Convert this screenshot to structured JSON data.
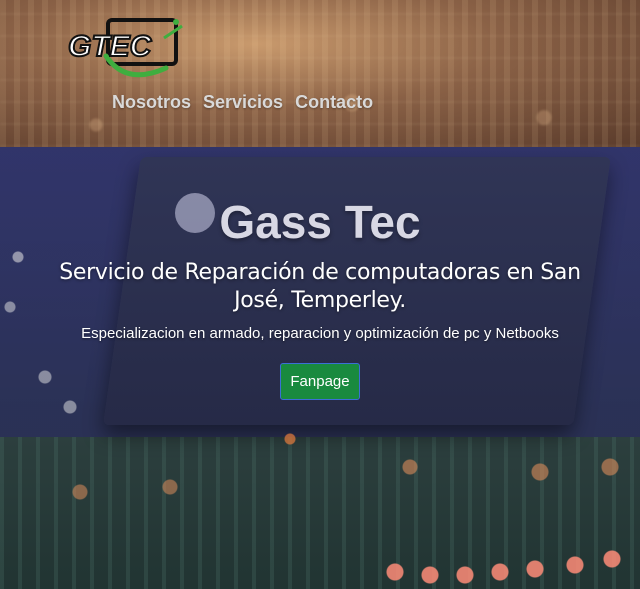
{
  "header": {
    "logo_text": "GTEC",
    "nav": [
      {
        "label": "Nosotros"
      },
      {
        "label": "Servicios"
      },
      {
        "label": "Contacto"
      }
    ]
  },
  "hero": {
    "title": "Gass Tec",
    "subtitle": "Servicio de Reparación de computadoras en San José, Temperley.",
    "description": "Especializacion en armado, reparacion y optimización de pc y Netbooks",
    "button_label": "Fanpage"
  },
  "colors": {
    "nav_text": "#d9d9d9",
    "button_bg": "#198a3f",
    "button_border": "#3b6fd6",
    "hero_overlay": "#28286e",
    "logo_green": "#3fae3f"
  }
}
